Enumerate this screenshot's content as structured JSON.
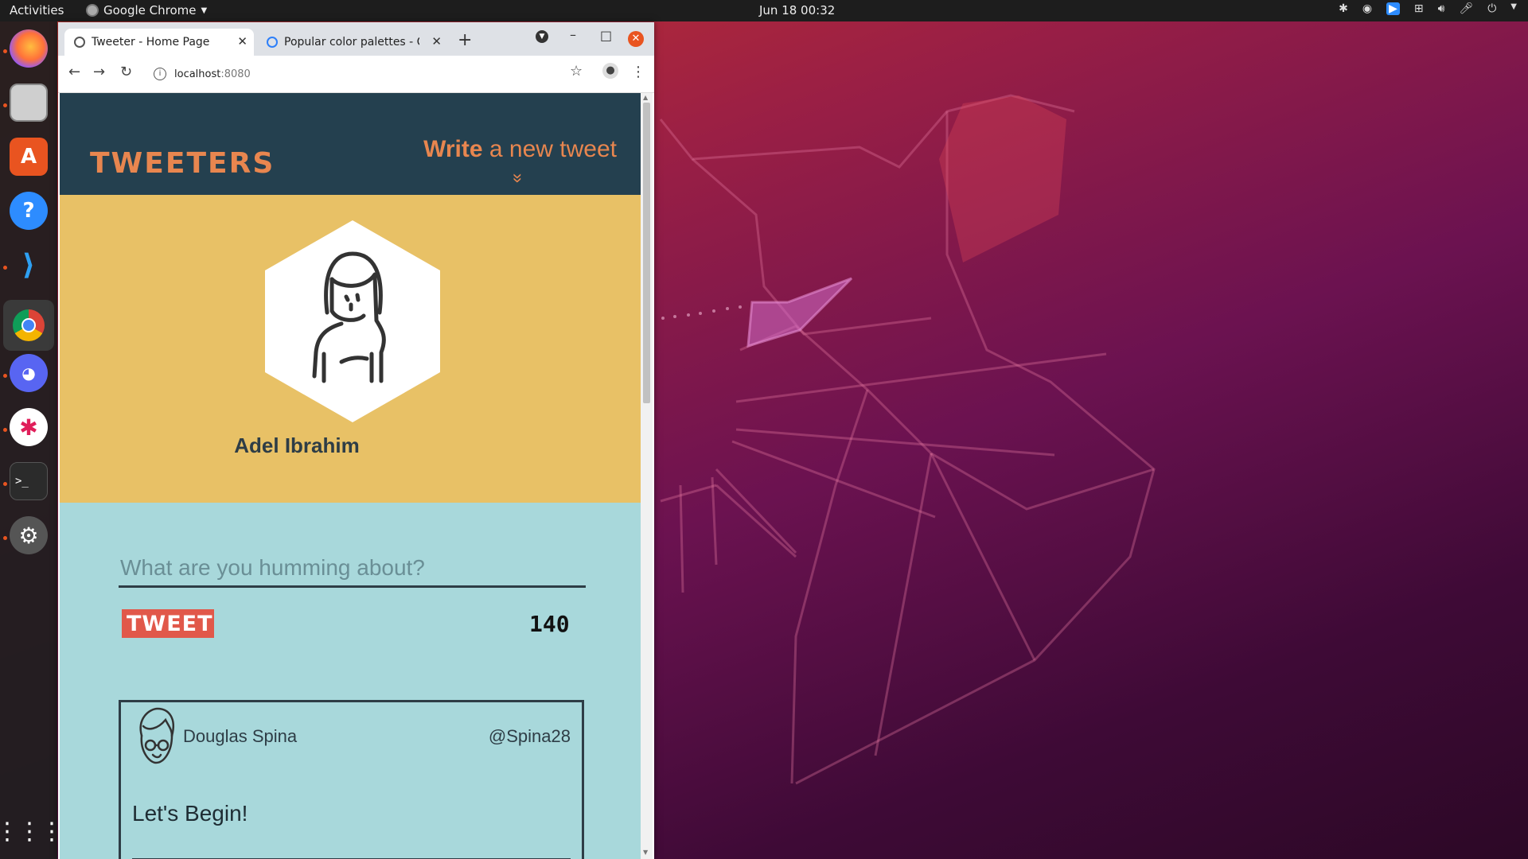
{
  "topbar": {
    "activities": "Activities",
    "app_name": "Google Chrome",
    "clock": "Jun 18  00:32"
  },
  "dock": {
    "items": [
      {
        "name": "firefox-icon"
      },
      {
        "name": "files-icon"
      },
      {
        "name": "software-center-icon"
      },
      {
        "name": "help-icon"
      },
      {
        "name": "vscode-icon"
      },
      {
        "name": "chrome-icon"
      },
      {
        "name": "discord-icon"
      },
      {
        "name": "slack-icon"
      },
      {
        "name": "terminal-icon"
      },
      {
        "name": "settings-icon"
      },
      {
        "name": "app-grid-icon"
      }
    ]
  },
  "browser": {
    "tabs": [
      {
        "title": "Tweeter - Home Page"
      },
      {
        "title": "Popular color palettes - Co"
      }
    ],
    "url_host": "localhost",
    "url_port": ":8080"
  },
  "page": {
    "brand": "TWEETERS",
    "compose_link_bold": "Write",
    "compose_link_rest": " a new tweet",
    "compose_arrow": "»",
    "profile_name": "Adel Ibrahim",
    "tweet_placeholder": "What are you humming about?",
    "tweet_button": "TWEET",
    "char_counter": "140",
    "tweets": [
      {
        "name": "Douglas Spina",
        "handle": "@Spina28",
        "text": "Let's Begin!"
      }
    ]
  },
  "colors": {
    "nav_bg": "#24404f",
    "accent_orange": "#e8864f",
    "profile_bg": "#e8c166",
    "compose_bg": "#a8d8db",
    "tweet_button_bg": "#e1584a"
  }
}
